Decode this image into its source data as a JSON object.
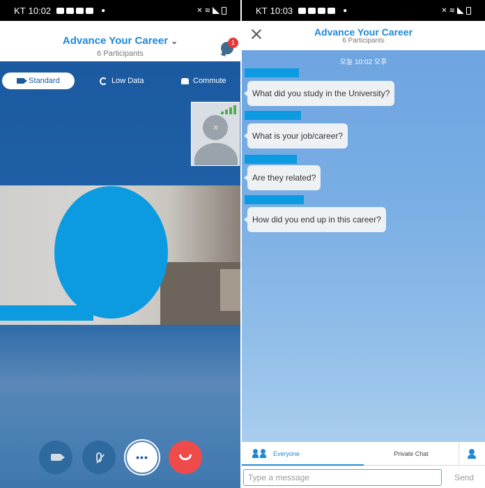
{
  "left": {
    "statusbar": {
      "carrier": "KT",
      "time": "10:02"
    },
    "header": {
      "title": "Advance Your Career",
      "chevron": "⌄",
      "participants": "6 Participants",
      "chat_badge": "1"
    },
    "modes": [
      {
        "label": "Standard",
        "icon": "video-camera-icon"
      },
      {
        "label": "Low Data",
        "icon": "low-data-icon"
      },
      {
        "label": "Commute",
        "icon": "car-icon"
      }
    ],
    "controls": {
      "more_label": "•••"
    }
  },
  "right": {
    "statusbar": {
      "carrier": "KT",
      "time": "10:03"
    },
    "header": {
      "title": "Advance Your Career",
      "participants": "6 Participants"
    },
    "timestamp": "오늘 10:02 오후",
    "messages": [
      {
        "text": "What did you study in the University?"
      },
      {
        "text": "What is your job/career?"
      },
      {
        "text": "Are they related?"
      },
      {
        "text": "How did you end up in this career?"
      }
    ],
    "tabs": {
      "everyone": "Everyone",
      "private": "Private Chat"
    },
    "composer": {
      "placeholder": "Type a message",
      "send": "Send"
    }
  },
  "colors": {
    "accent": "#1e88d6",
    "end_call": "#ef4b4b",
    "redaction": "#0c9be0",
    "signal": "#4caf50"
  }
}
